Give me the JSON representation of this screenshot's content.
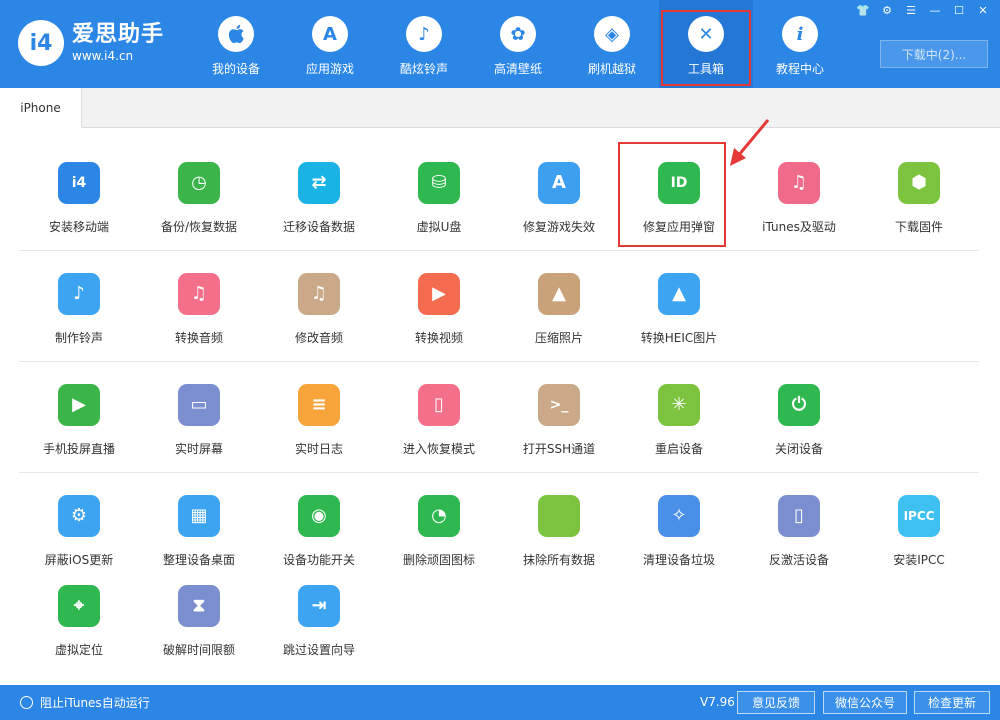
{
  "brand": {
    "name": "爱思助手",
    "url": "www.i4.cn",
    "badge": "i4"
  },
  "nav": [
    {
      "label": "我的设备",
      "icon": "apple-icon",
      "glyph": ""
    },
    {
      "label": "应用游戏",
      "icon": "app-store-icon",
      "glyph": "A"
    },
    {
      "label": "酷炫铃声",
      "icon": "bell-icon",
      "glyph": "♪"
    },
    {
      "label": "高清壁纸",
      "icon": "flower-icon",
      "glyph": "✿"
    },
    {
      "label": "刷机越狱",
      "icon": "box-icon",
      "glyph": "◈"
    },
    {
      "label": "工具箱",
      "icon": "tools-icon",
      "glyph": "✕"
    },
    {
      "label": "教程中心",
      "icon": "info-icon",
      "glyph": "i"
    }
  ],
  "download_button": "下载中(2)...",
  "device_tab": "iPhone",
  "tools": {
    "row1": [
      {
        "label": "安装移动端",
        "icon": "i4-app-icon",
        "glyph": "i4",
        "color": "#2b86e6"
      },
      {
        "label": "备份/恢复数据",
        "icon": "backup-clock-icon",
        "glyph": "◷",
        "color": "#3bb54a"
      },
      {
        "label": "迁移设备数据",
        "icon": "migrate-phones-icon",
        "glyph": "⇄",
        "color": "#1ab3e6"
      },
      {
        "label": "虚拟U盘",
        "icon": "usb-drive-icon",
        "glyph": "⛁",
        "color": "#2fb84f"
      },
      {
        "label": "修复游戏失效",
        "icon": "app-store-repair-icon",
        "glyph": "A",
        "color": "#3d9ff0"
      },
      {
        "label": "修复应用弹窗",
        "icon": "apple-id-icon",
        "glyph": "ID",
        "color": "#2fb84f"
      },
      {
        "label": "iTunes及驱动",
        "icon": "itunes-gear-icon",
        "glyph": "♫",
        "color": "#f06b8a"
      },
      {
        "label": "下载固件",
        "icon": "cube-icon",
        "glyph": "⬢",
        "color": "#7cc43f"
      }
    ],
    "row2": [
      {
        "label": "制作铃声",
        "icon": "bell-plus-icon",
        "glyph": "♪",
        "color": "#3ca4f0"
      },
      {
        "label": "转换音频",
        "icon": "music-note-icon",
        "glyph": "♫",
        "color": "#f46f8a"
      },
      {
        "label": "修改音频",
        "icon": "music-edit-icon",
        "glyph": "♫",
        "color": "#c9a987"
      },
      {
        "label": "转换视频",
        "icon": "video-play-icon",
        "glyph": "▶",
        "color": "#f46c4f"
      },
      {
        "label": "压缩照片",
        "icon": "photo-icon",
        "glyph": "▲",
        "color": "#caa27a"
      },
      {
        "label": "转换HEIC图片",
        "icon": "heic-convert-icon",
        "glyph": "▲",
        "color": "#3ca4f0"
      }
    ],
    "row3": [
      {
        "label": "手机投屏直播",
        "icon": "screen-cast-icon",
        "glyph": "▶",
        "color": "#3bb54a"
      },
      {
        "label": "实时屏幕",
        "icon": "monitor-icon",
        "glyph": "▭",
        "color": "#7b8fd0"
      },
      {
        "label": "实时日志",
        "icon": "log-document-icon",
        "glyph": "≡",
        "color": "#f7a43a"
      },
      {
        "label": "进入恢复模式",
        "icon": "recovery-phone-icon",
        "glyph": "▯",
        "color": "#f46f8a"
      },
      {
        "label": "打开SSH通道",
        "icon": "terminal-icon",
        "glyph": ">_",
        "color": "#c9a987"
      },
      {
        "label": "重启设备",
        "icon": "restart-spinner-icon",
        "glyph": "✳",
        "color": "#7cc43f"
      },
      {
        "label": "关闭设备",
        "icon": "power-icon",
        "glyph": "⏻",
        "color": "#2fb84f"
      }
    ],
    "row4": [
      {
        "label": "屏蔽iOS更新",
        "icon": "block-update-gear-icon",
        "glyph": "⚙",
        "color": "#3ca4f0"
      },
      {
        "label": "整理设备桌面",
        "icon": "grid-icon",
        "glyph": "▦",
        "color": "#3ca4f0"
      },
      {
        "label": "设备功能开关",
        "icon": "toggle-switch-icon",
        "glyph": "◉",
        "color": "#2fb84f"
      },
      {
        "label": "删除顽固图标",
        "icon": "pie-chart-icon",
        "glyph": "◔",
        "color": "#2fb84f"
      },
      {
        "label": "抹除所有数据",
        "icon": "apple-erase-icon",
        "glyph": "",
        "color": "#7cc43f"
      },
      {
        "label": "清理设备垃圾",
        "icon": "broom-icon",
        "glyph": "✧",
        "color": "#4a8fe8"
      },
      {
        "label": "反激活设备",
        "icon": "tablet-icon",
        "glyph": "▯",
        "color": "#7b8fd0"
      },
      {
        "label": "安装IPCC",
        "icon": "ipcc-icon",
        "glyph": "IPCC",
        "color": "#3ec0f0"
      },
      {
        "label": "虚拟定位",
        "icon": "location-pin-icon",
        "glyph": "⌖",
        "color": "#2fb84f"
      },
      {
        "label": "破解时间限额",
        "icon": "hourglass-icon",
        "glyph": "⧗",
        "color": "#7b8fd0"
      },
      {
        "label": "跳过设置向导",
        "icon": "skip-setup-icon",
        "glyph": "⇥",
        "color": "#3ca4f0"
      }
    ]
  },
  "footer": {
    "itunes_toggle": "阻止iTunes自动运行",
    "version": "V7.96",
    "feedback": "意见反馈",
    "wechat": "微信公众号",
    "check_update": "检查更新"
  }
}
